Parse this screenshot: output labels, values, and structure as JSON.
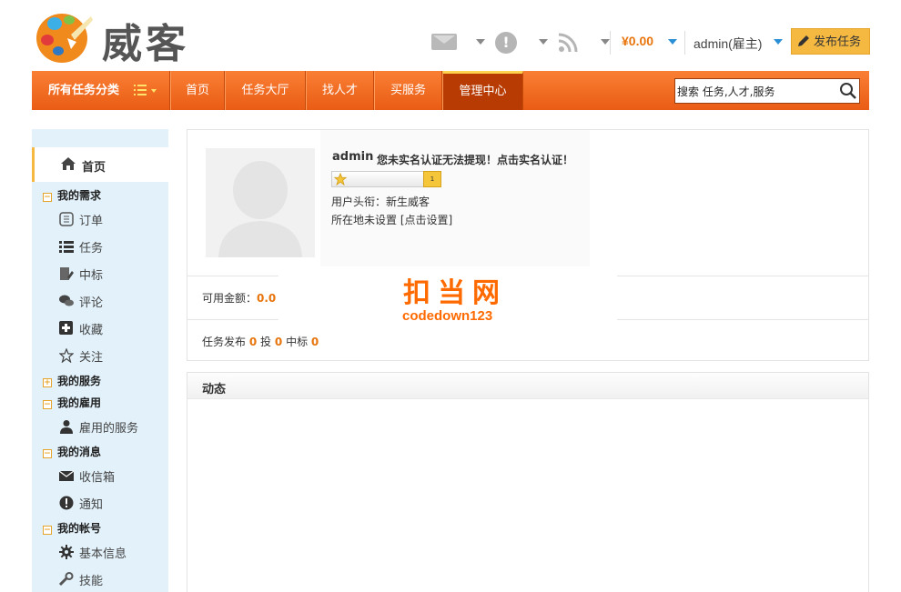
{
  "brand": {
    "name": "威客",
    "accent": "#ea5c15",
    "highlight": "#f5b942"
  },
  "toolbar": {
    "mail_icon": "mail-icon",
    "notice_icon": "exclamation-icon",
    "rss_icon": "rss-icon",
    "balance": "¥0.00",
    "user": "admin(雇主)",
    "publish_label": "发布任务"
  },
  "nav": {
    "category_label": "所有任务分类",
    "items": [
      {
        "label": "首页"
      },
      {
        "label": "任务大厅"
      },
      {
        "label": "找人才"
      },
      {
        "label": "买服务"
      },
      {
        "label": "管理中心",
        "active": true
      }
    ],
    "search": {
      "value": "搜索 任务,人才,服务"
    }
  },
  "sidebar": {
    "home": "首页",
    "groups": {
      "demand": "我的需求",
      "service": "我的服务",
      "hire": "我的雇用",
      "message": "我的消息",
      "account": "我的帐号"
    },
    "items": {
      "order": "订单",
      "task": "任务",
      "win": "中标",
      "comment": "评论",
      "favorite": "收藏",
      "follow": "关注",
      "hired_service": "雇用的服务",
      "inbox": "收信箱",
      "notice": "通知",
      "basic_info": "基本信息",
      "skill": "技能"
    }
  },
  "profile": {
    "username": "admin",
    "verify_msg": "您未实名认证无法提现！点击实名认证！",
    "level": "1",
    "title_line": "用户头衔：新生威客",
    "location_line": "所在地未设置 [点击设置]",
    "balance_label": "可用金额：",
    "balance_value": "0.0",
    "task_publish_label": "任务发布",
    "task_publish_value": "0",
    "bid_label": "投",
    "bid_value": "0",
    "win_label": "中标",
    "win_value": "0"
  },
  "watermark": {
    "title": "扣当网",
    "sub": "codedown123"
  },
  "dynamics": {
    "title": "动态"
  }
}
